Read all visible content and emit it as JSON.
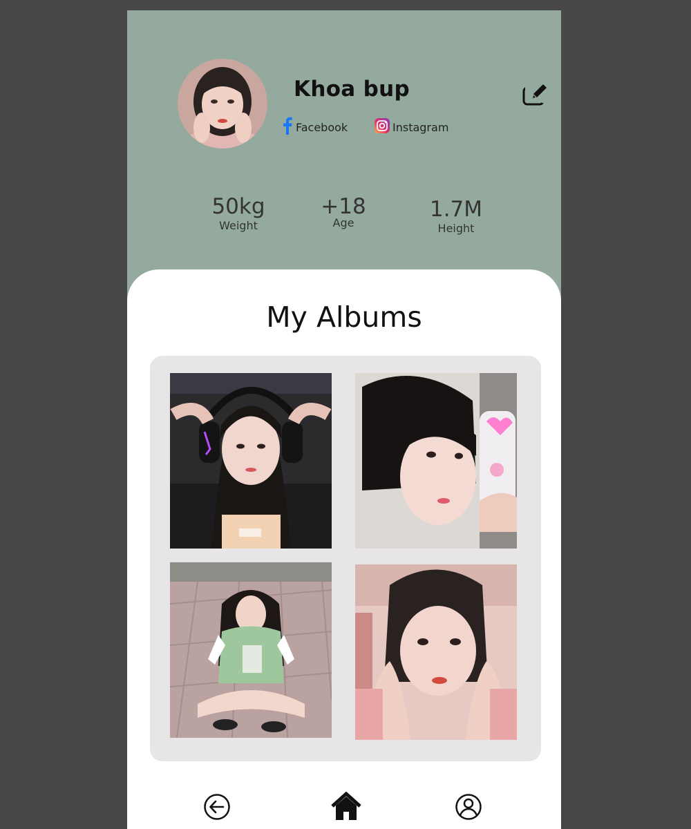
{
  "profile": {
    "name": "Khoa bup",
    "facebook_label": "Facebook",
    "instagram_label": "Instagram"
  },
  "stats": [
    {
      "value": "50kg",
      "label": "Weight"
    },
    {
      "value": "+18",
      "label": "Age"
    },
    {
      "value": "1.7M",
      "label": "Height"
    }
  ],
  "albums": {
    "title": "My Albums"
  },
  "icons": {
    "edit": "edit-icon",
    "facebook": "facebook-icon",
    "instagram": "instagram-icon",
    "back": "back-arrow-icon",
    "home": "home-icon",
    "profile": "user-icon"
  },
  "colors": {
    "header_bg": "#95aa9f",
    "sheet_bg": "#ffffff",
    "album_box_bg": "#e7e5e6",
    "facebook_blue": "#1877f2"
  }
}
